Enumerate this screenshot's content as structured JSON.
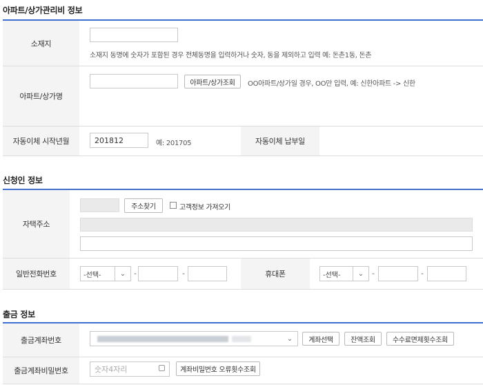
{
  "apartment_section": {
    "title": "아파트/상가관리비 정보",
    "location_label": "소재지",
    "location_value": "",
    "location_help": "소재지 동명에 숫자가 포함된 경우 전체동명을 입력하거나 숫자, 동을 제외하고 입력 예: 돈촌1동, 돈촌",
    "apt_name_label": "아파트/상가명",
    "apt_name_value": "",
    "apt_lookup_button": "아파트/상가조회",
    "apt_name_help": "OO아파트/상가일 경우, OO만 입력, 예: 신한아파트 -> 신한",
    "start_month_label": "자동이체 시작년월",
    "start_month_value": "201812",
    "start_month_example": "예: 201705",
    "pay_day_label": "자동이체 납부일"
  },
  "applicant_section": {
    "title": "신청인 정보",
    "address_label": "자택주소",
    "find_address_button": "주소찾기",
    "import_customer_label": "고객정보 가져오기",
    "phone_label": "일반전화번호",
    "phone_select": "-선택-",
    "mobile_label": "휴대폰",
    "mobile_select": "-선택-",
    "dash": "-"
  },
  "withdraw_section": {
    "title": "출금 정보",
    "account_label": "출금계좌번호",
    "account_select_button": "계좌선택",
    "balance_button": "잔액조회",
    "fee_waiver_button": "수수료면제횟수조회",
    "password_label": "출금계좌비밀번호",
    "password_placeholder": "숫자4자리",
    "password_error_button": "계좌비밀번호 오류횟수조회"
  }
}
